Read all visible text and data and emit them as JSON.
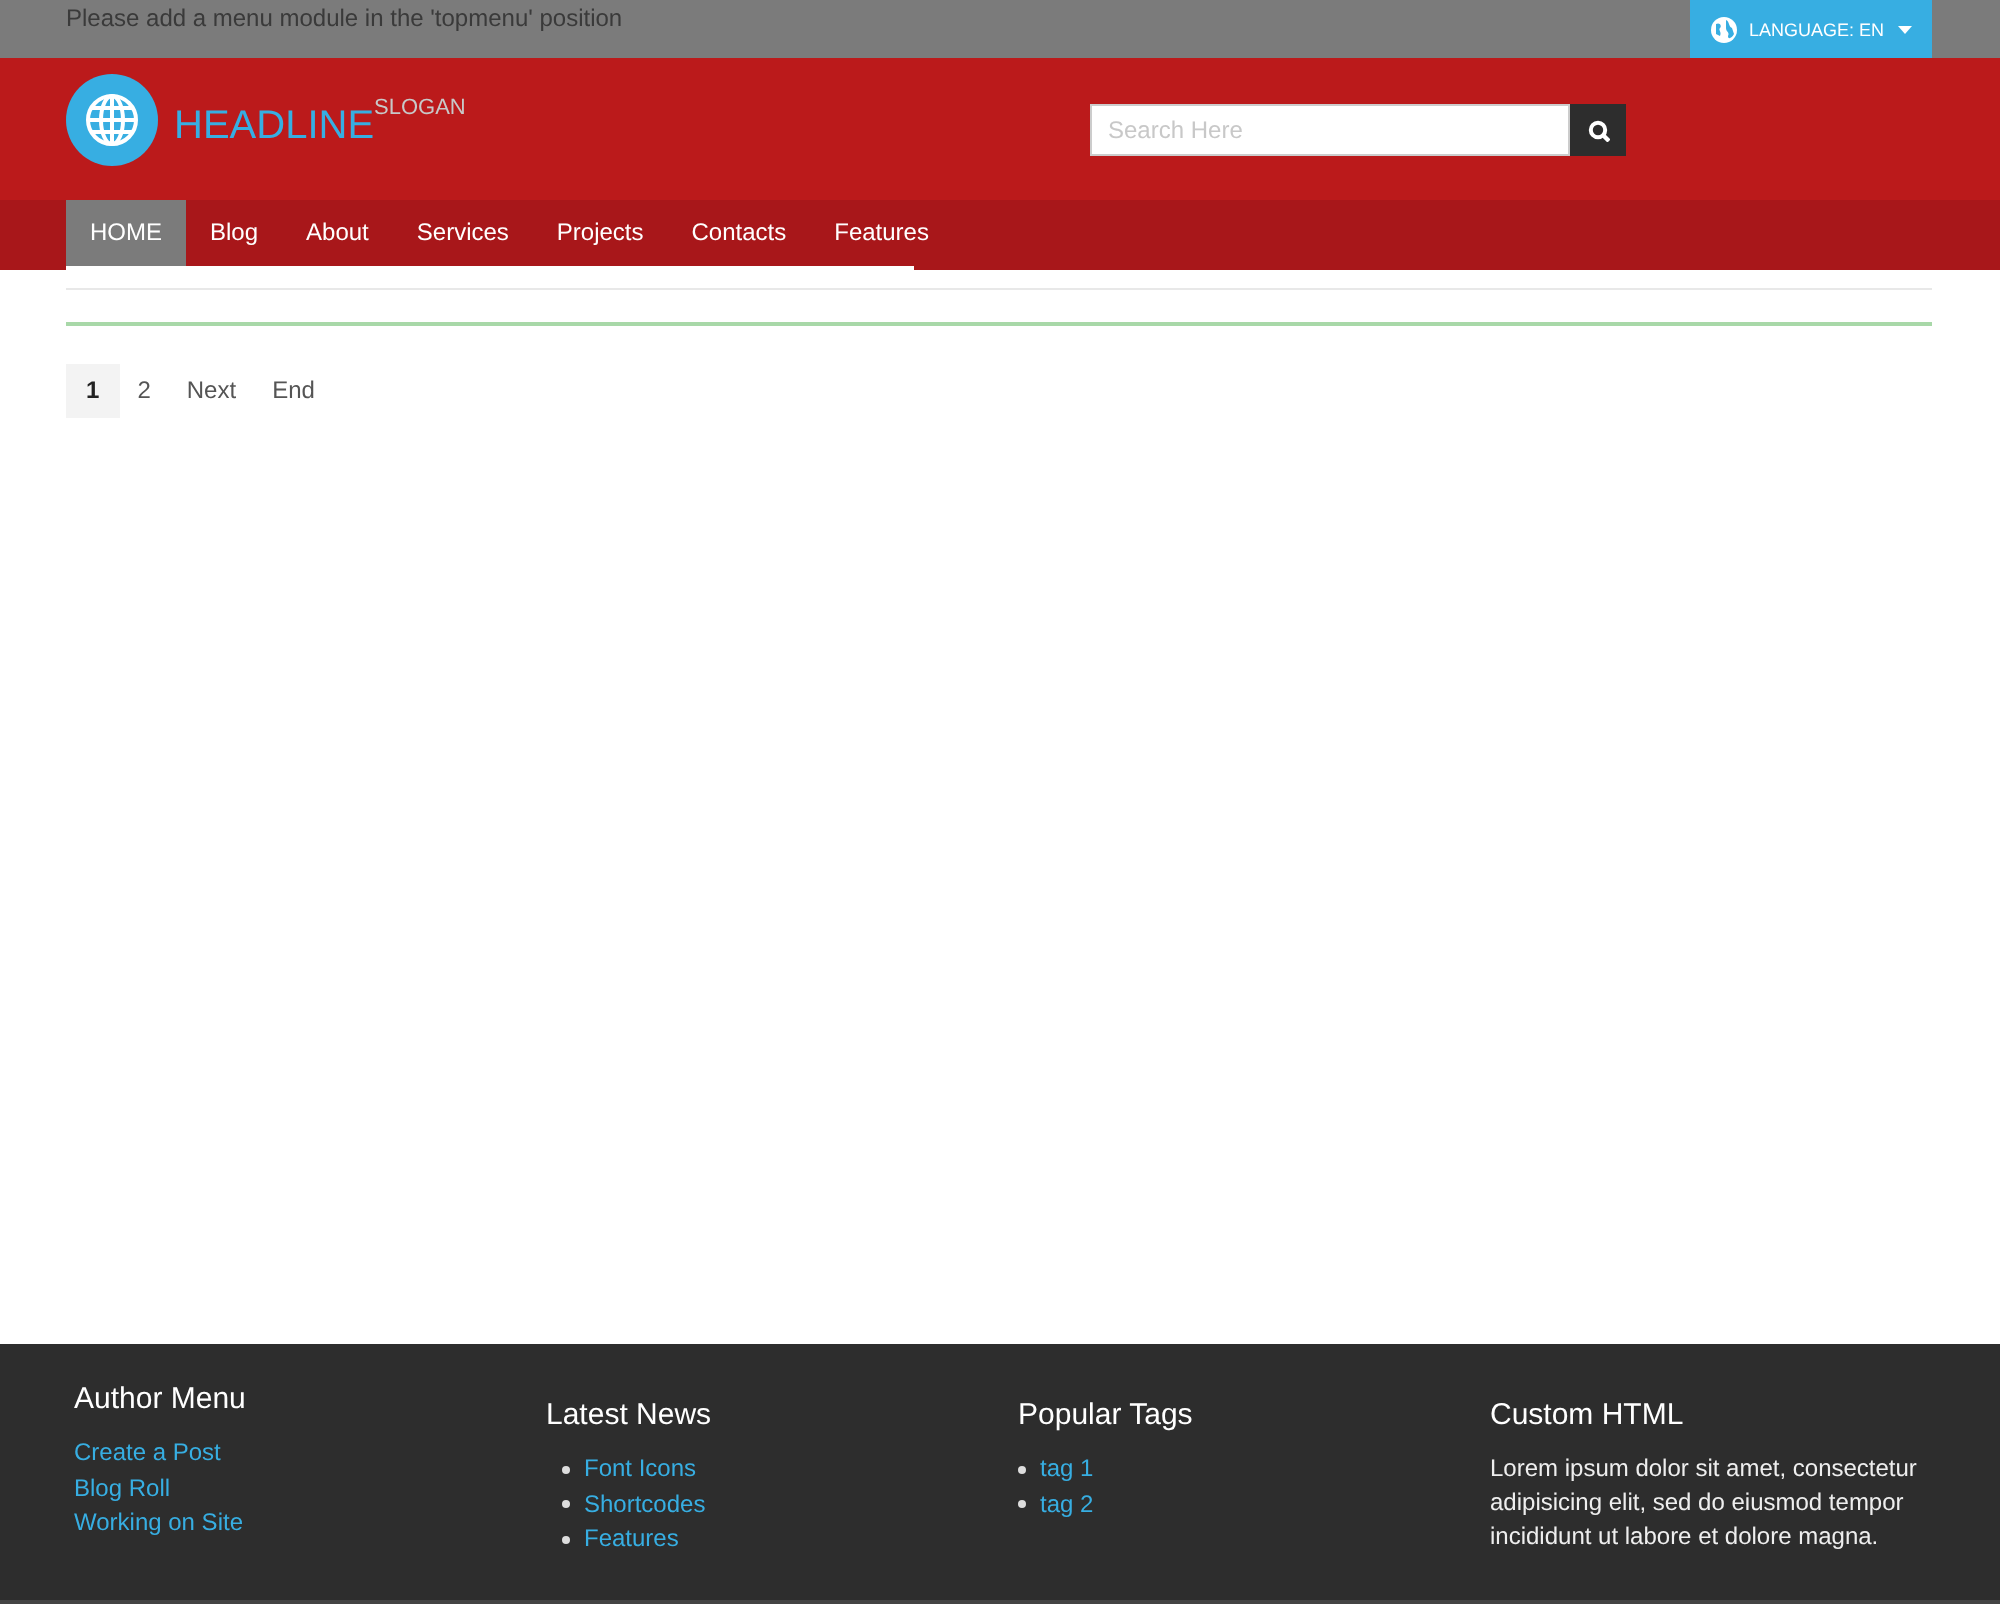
{
  "top_bar": {
    "notice": "Please add a menu module in the 'topmenu' position",
    "language_button": "LANGUAGE: EN"
  },
  "header": {
    "logo_title": "HEADLINE",
    "slogan": "SLOGAN",
    "search": {
      "placeholder": "Search Here"
    }
  },
  "nav": [
    {
      "label": "HOME",
      "selected": true
    },
    {
      "label": "Blog",
      "selected": false
    },
    {
      "label": "About",
      "selected": false
    },
    {
      "label": "Services",
      "selected": false
    },
    {
      "label": "Projects",
      "selected": false
    },
    {
      "label": "Contacts",
      "selected": false
    },
    {
      "label": "Features",
      "selected": false
    }
  ],
  "pagination": [
    {
      "label": "1",
      "selected": true
    },
    {
      "label": "2",
      "selected": false
    },
    {
      "label": "Next",
      "selected": false
    },
    {
      "label": "End",
      "selected": false
    }
  ],
  "footer": [
    {
      "title": "Author Menu",
      "kind": "links",
      "items": [
        "Create a Post",
        "Blog Roll",
        "Working on Site"
      ]
    },
    {
      "title": "Latest News",
      "kind": "bullets",
      "items": [
        "Font Icons",
        "Shortcodes",
        "Features"
      ]
    },
    {
      "title": "Popular Tags",
      "kind": "bullets",
      "items": [
        "tag 1",
        "tag 2"
      ]
    },
    {
      "title": "Custom HTML",
      "kind": "text",
      "text": "Lorem ipsum dolor sit amet, consectetur adipisicing elit, sed do eiusmod tempor incididunt ut labore et dolore magna."
    }
  ]
}
